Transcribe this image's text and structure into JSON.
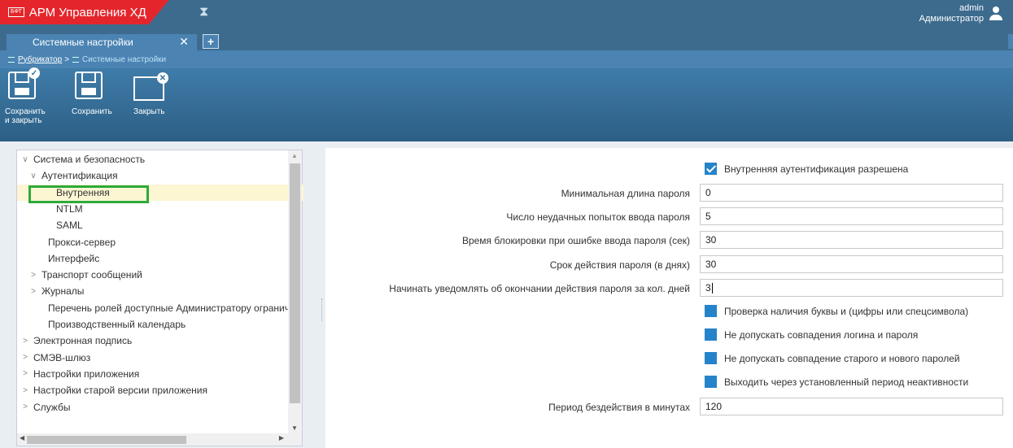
{
  "app": {
    "logo_text": "БФТ",
    "title": "АРМ Управления ХД",
    "user_name": "admin",
    "user_role": "Администратор"
  },
  "tabs": {
    "active_label": "Системные настройки",
    "close_glyph": "✕",
    "add_glyph": "+"
  },
  "breadcrumb": {
    "root": "Рубрикатор",
    "separator": ">",
    "current": "Системные настройки"
  },
  "toolbar": {
    "save_close_line1": "Сохранить",
    "save_close_line2": "и закрыть",
    "save_label": "Сохранить",
    "close_label": "Закрыть"
  },
  "tree": {
    "items": [
      {
        "label": "Система и безопасность",
        "chevron": "∨"
      },
      {
        "label": "Аутентификация",
        "chevron": "∨"
      },
      {
        "label": "Внутренняя",
        "chevron": ""
      },
      {
        "label": "NTLM",
        "chevron": ""
      },
      {
        "label": "SAML",
        "chevron": ""
      },
      {
        "label": "Прокси-сервер",
        "chevron": ""
      },
      {
        "label": "Интерфейс",
        "chevron": ""
      },
      {
        "label": "Транспорт сообщений",
        "chevron": ">"
      },
      {
        "label": "Журналы",
        "chevron": ">"
      },
      {
        "label": "Перечень ролей доступные Администратору ограничений",
        "chevron": ""
      },
      {
        "label": "Производственный календарь",
        "chevron": ""
      },
      {
        "label": "Электронная подпись",
        "chevron": ">"
      },
      {
        "label": "СМЭВ-шлюз",
        "chevron": ">"
      },
      {
        "label": "Настройки приложения",
        "chevron": ">"
      },
      {
        "label": "Настройки старой версии приложения",
        "chevron": ">"
      },
      {
        "label": "Службы",
        "chevron": ">"
      }
    ]
  },
  "form": {
    "internal_auth_label": "Внутренняя аутентификация разрешена",
    "internal_auth_checked": true,
    "fields": [
      {
        "label": "Минимальная длина пароля",
        "value": "0"
      },
      {
        "label": "Число неудачных попыток ввода пароля",
        "value": "5"
      },
      {
        "label": "Время блокировки при ошибке ввода пароля (сек)",
        "value": "30"
      },
      {
        "label": "Срок действия пароля (в днях)",
        "value": "30"
      },
      {
        "label": "Начинать уведомлять об окончании действия пароля за кол. дней",
        "value": "3"
      }
    ],
    "checkboxes": [
      {
        "label": "Проверка наличия буквы и (цифры или спецсимвола)",
        "checked": false
      },
      {
        "label": "Не допускать совпадения логина и пароля",
        "checked": false
      },
      {
        "label": "Не допускать совпадение старого и нового паролей",
        "checked": false
      },
      {
        "label": "Выходить через установленный период неактивности",
        "checked": false
      }
    ],
    "idle_period_label": "Период бездействия в минутах",
    "idle_period_value": "120"
  },
  "colors": {
    "header": "#3d6b8e",
    "brand_red": "#e4262c",
    "accent_blue": "#2583c9",
    "selection_outline": "#2daa3a"
  }
}
